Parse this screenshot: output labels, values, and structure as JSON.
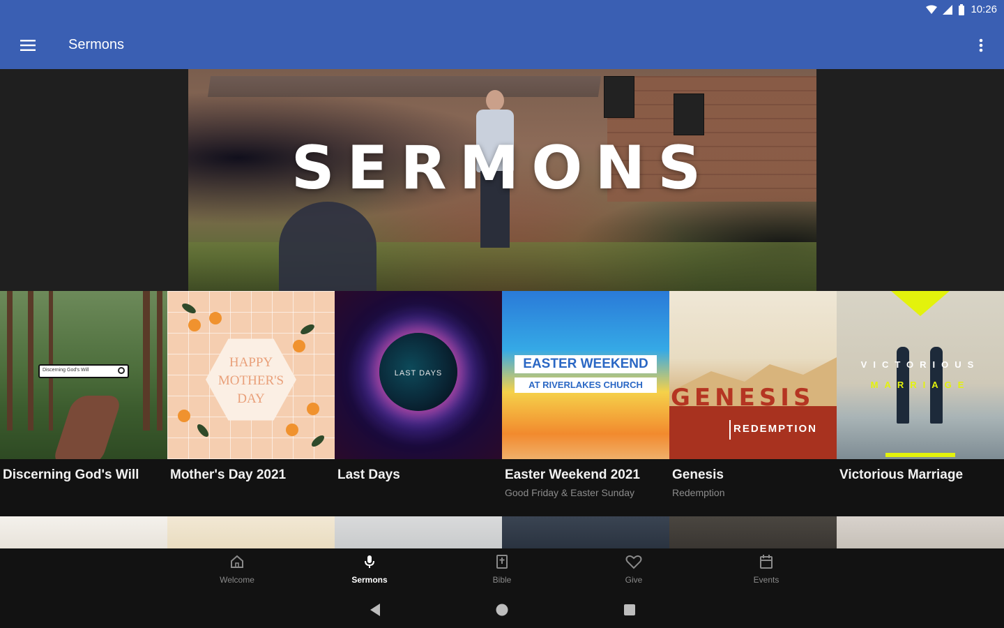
{
  "status_bar": {
    "time": "10:26"
  },
  "app_bar": {
    "title": "Sermons"
  },
  "hero": {
    "title": "SERMONS"
  },
  "sermons": [
    {
      "title": "Discerning God's Will",
      "subtitle": "",
      "thumb_text": "Discerning God's Will"
    },
    {
      "title": "Mother's Day 2021",
      "subtitle": "",
      "thumb_text": "HAPPY MOTHER'S DAY"
    },
    {
      "title": "Last Days",
      "subtitle": "",
      "thumb_text": "LAST DAYS"
    },
    {
      "title": "Easter Weekend 2021",
      "subtitle": "Good Friday & Easter Sunday",
      "thumb_line1": "EASTER WEEKEND",
      "thumb_line2": "AT RIVERLAKES CHURCH"
    },
    {
      "title": "Genesis",
      "subtitle": "Redemption",
      "thumb_line1": "GENESIS",
      "thumb_line2": "REDEMPTION"
    },
    {
      "title": "Victorious Marriage",
      "subtitle": "",
      "thumb_line1": "VICTORIOUS",
      "thumb_line2": "MARRIAGE"
    }
  ],
  "bottom_nav": [
    {
      "label": "Welcome",
      "icon": "home-icon",
      "active": false
    },
    {
      "label": "Sermons",
      "icon": "microphone-icon",
      "active": true
    },
    {
      "label": "Bible",
      "icon": "bible-icon",
      "active": false
    },
    {
      "label": "Give",
      "icon": "heart-icon",
      "active": false
    },
    {
      "label": "Events",
      "icon": "calendar-icon",
      "active": false
    }
  ],
  "colors": {
    "app_bar": "#3a5fb3",
    "background": "#121212",
    "active_nav": "#ffffff",
    "inactive_nav": "#8a8a8a"
  }
}
